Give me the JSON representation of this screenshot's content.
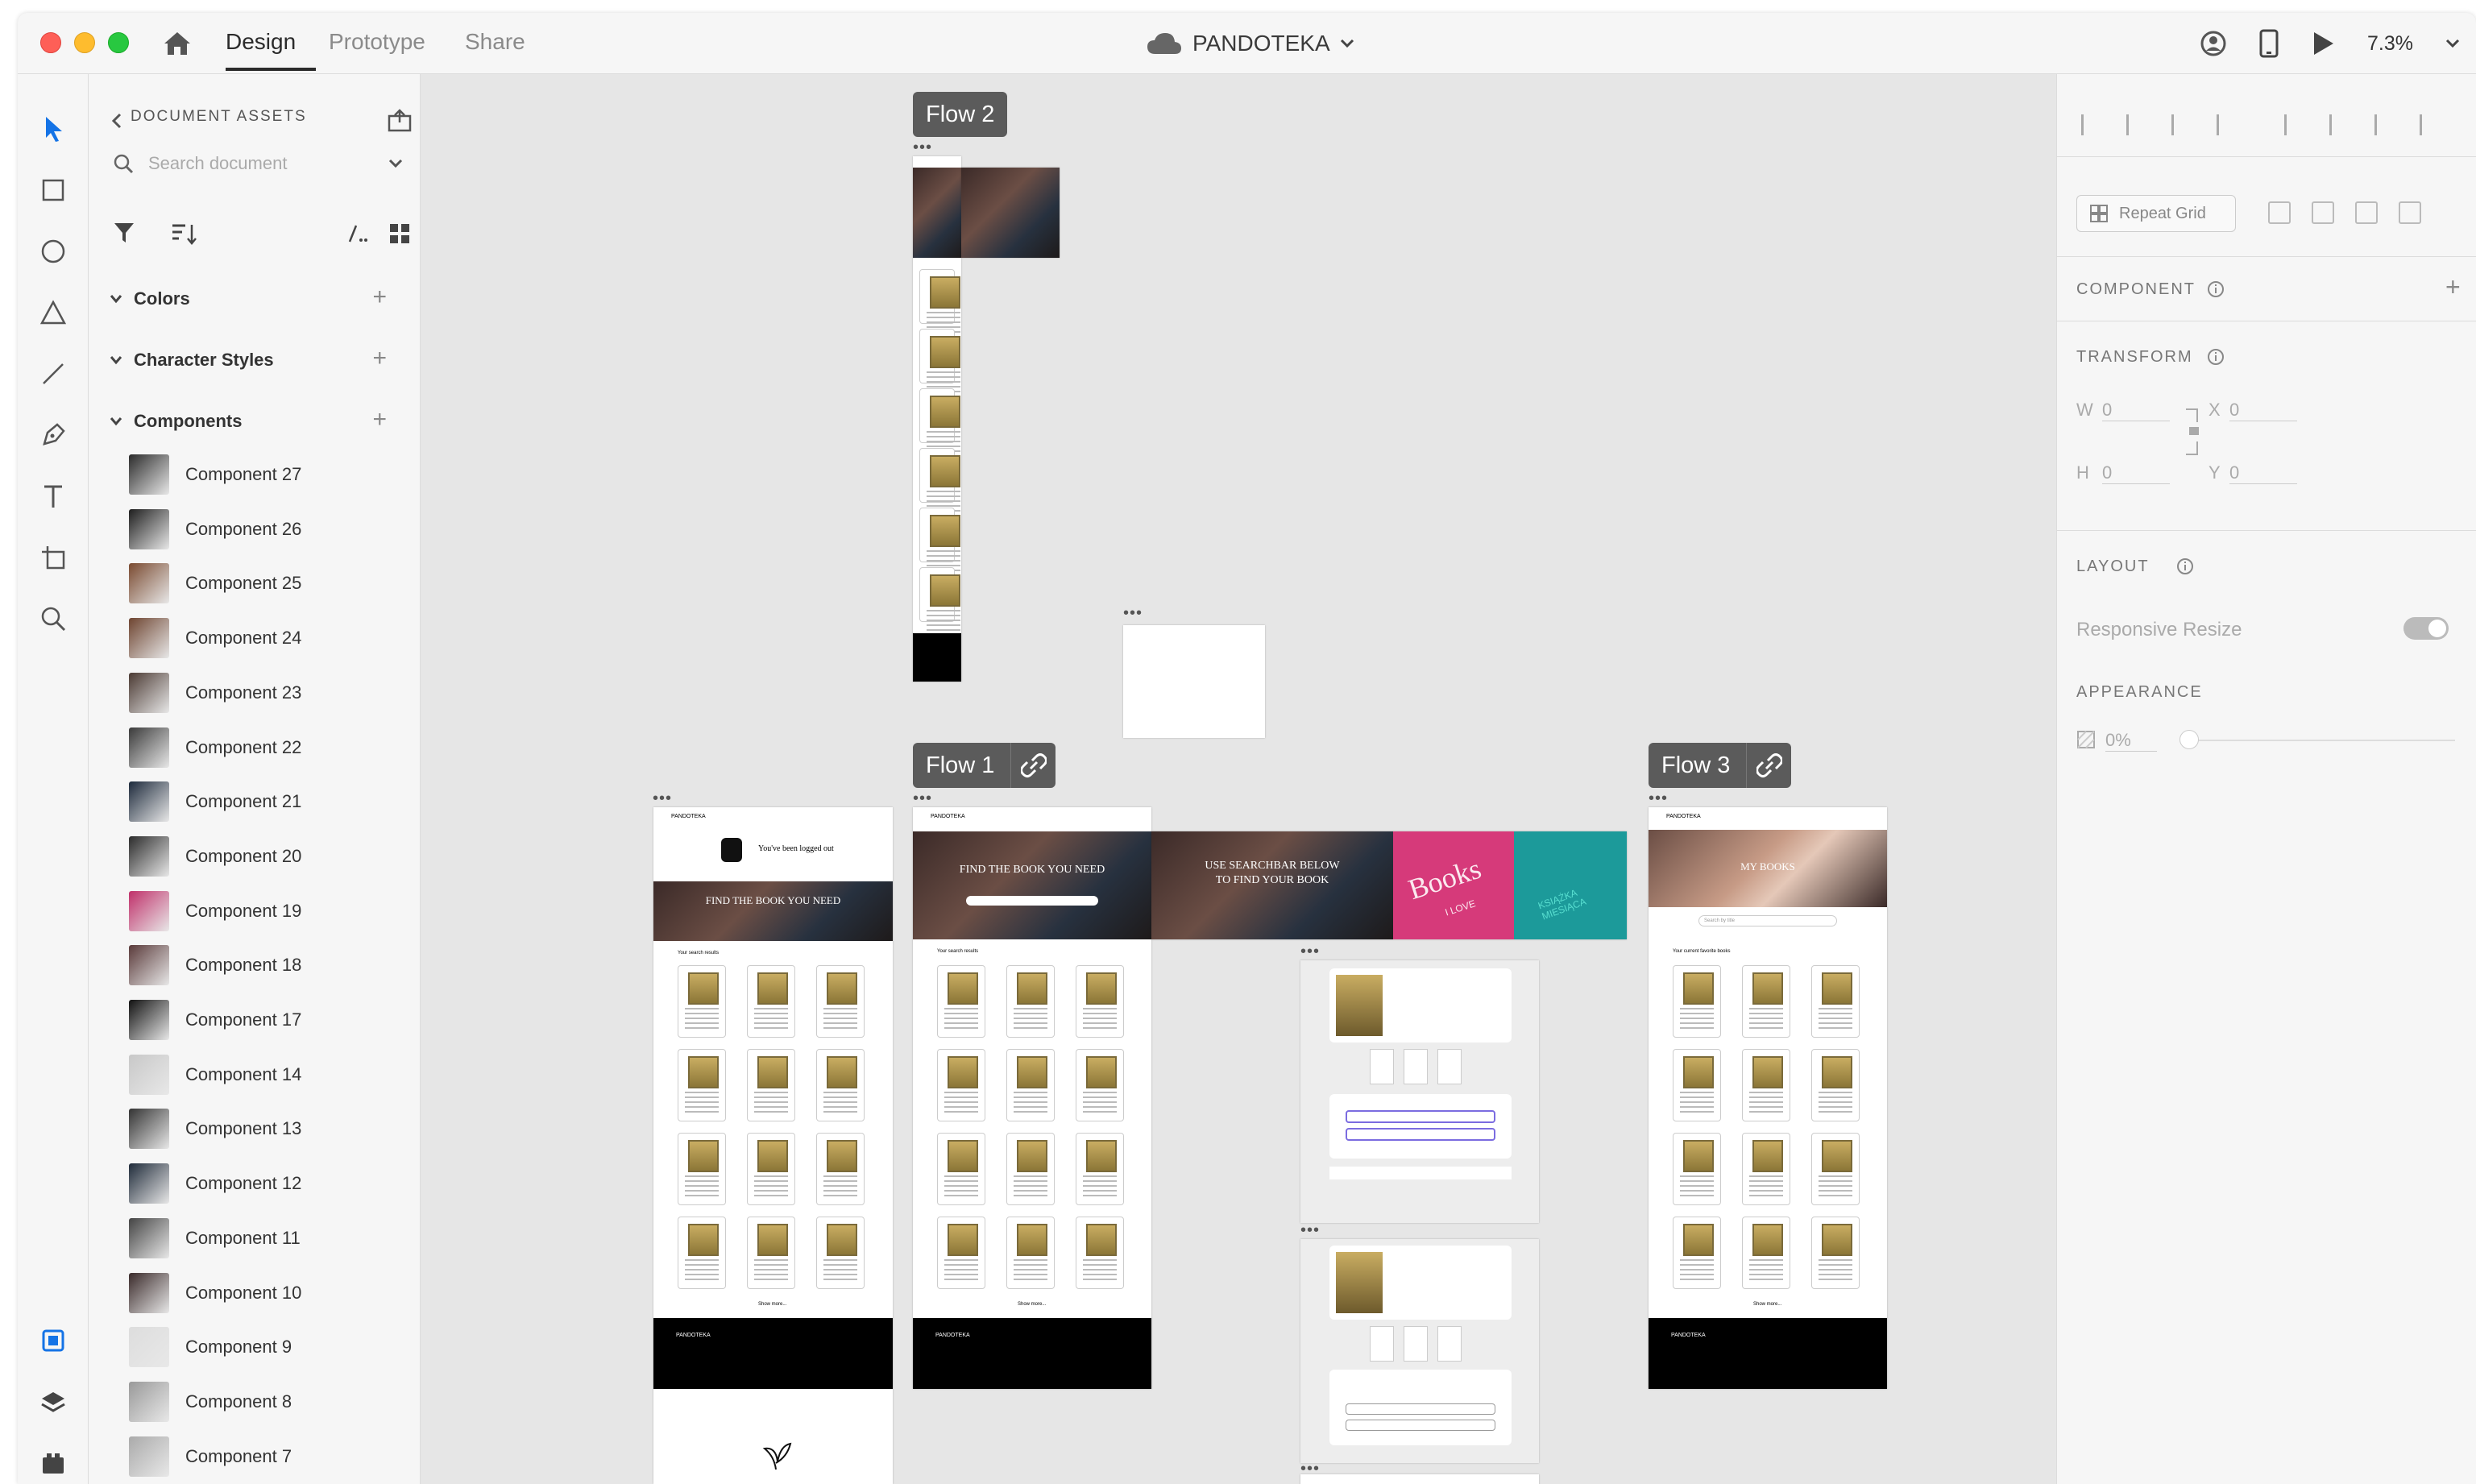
{
  "app": {
    "tabs": [
      {
        "label": "Design"
      },
      {
        "label": "Prototype"
      },
      {
        "label": "Share"
      }
    ],
    "document_title": "PANDOTEKA",
    "zoom": "7.3%"
  },
  "assets": {
    "header": "DOCUMENT ASSETS",
    "search_placeholder": "Search document",
    "sections": [
      {
        "label": "Colors"
      },
      {
        "label": "Character Styles"
      },
      {
        "label": "Components"
      }
    ],
    "components": [
      {
        "name": "Component 27",
        "thumb": "#2b2b2b"
      },
      {
        "name": "Component 26",
        "thumb": "#1e1e1e"
      },
      {
        "name": "Component 25",
        "thumb": "#7a4a30"
      },
      {
        "name": "Component 24",
        "thumb": "#6e4430"
      },
      {
        "name": "Component 23",
        "thumb": "#4b3a33"
      },
      {
        "name": "Component 22",
        "thumb": "#3a3a3a"
      },
      {
        "name": "Component 21",
        "thumb": "#1d2a3c"
      },
      {
        "name": "Component 20",
        "thumb": "#2b2b2b"
      },
      {
        "name": "Component 19",
        "thumb": "#c0306a"
      },
      {
        "name": "Component 18",
        "thumb": "#5a3a3a"
      },
      {
        "name": "Component 17",
        "thumb": "#111111"
      },
      {
        "name": "Component 14",
        "thumb": "#c8c8c8"
      },
      {
        "name": "Component 13",
        "thumb": "#333333"
      },
      {
        "name": "Component 12",
        "thumb": "#1f2b3a"
      },
      {
        "name": "Component 11",
        "thumb": "#444444"
      },
      {
        "name": "Component 10",
        "thumb": "#3a2a2a"
      },
      {
        "name": "Component 9",
        "thumb": "#dddddd"
      },
      {
        "name": "Component 8",
        "thumb": "#999999"
      },
      {
        "name": "Component 7",
        "thumb": "#aaaaaa"
      }
    ]
  },
  "canvas": {
    "flow_labels": [
      "Flow 2",
      "Flow 1",
      "Flow 3"
    ],
    "boards": {
      "logout": {
        "logo": "PANDOTEKA",
        "message": "You've been logged out",
        "hero": "FIND THE BOOK YOU NEED",
        "section": "Your search results",
        "more": "Show more..."
      },
      "home": {
        "logo": "PANDOTEKA",
        "hero": "FIND THE BOOK YOU NEED",
        "section": "Your search results",
        "more": "Show more..."
      },
      "banner": {
        "text1": "USE SEARCHBAR BELOW",
        "text2": "TO FIND YOUR BOOK",
        "books": "Books",
        "love": "I LOVE",
        "ksiazka": "KSIĄŻKA MIESIĄCA"
      },
      "mybooks": {
        "logo": "PANDOTEKA",
        "hero": "MY BOOKS",
        "search": "Search by title",
        "section": "Your current favorite books",
        "more": "Show more..."
      },
      "footer": "PANDOTEKA"
    }
  },
  "properties": {
    "component_label": "COMPONENT",
    "repeat_grid": "Repeat Grid",
    "transform_label": "TRANSFORM",
    "w_label": "W",
    "w_value": "0",
    "x_label": "X",
    "x_value": "0",
    "h_label": "H",
    "h_value": "0",
    "y_label": "Y",
    "y_value": "0",
    "layout_label": "LAYOUT",
    "responsive_resize": "Responsive Resize",
    "appearance_label": "APPEARANCE",
    "opacity": "0%"
  }
}
